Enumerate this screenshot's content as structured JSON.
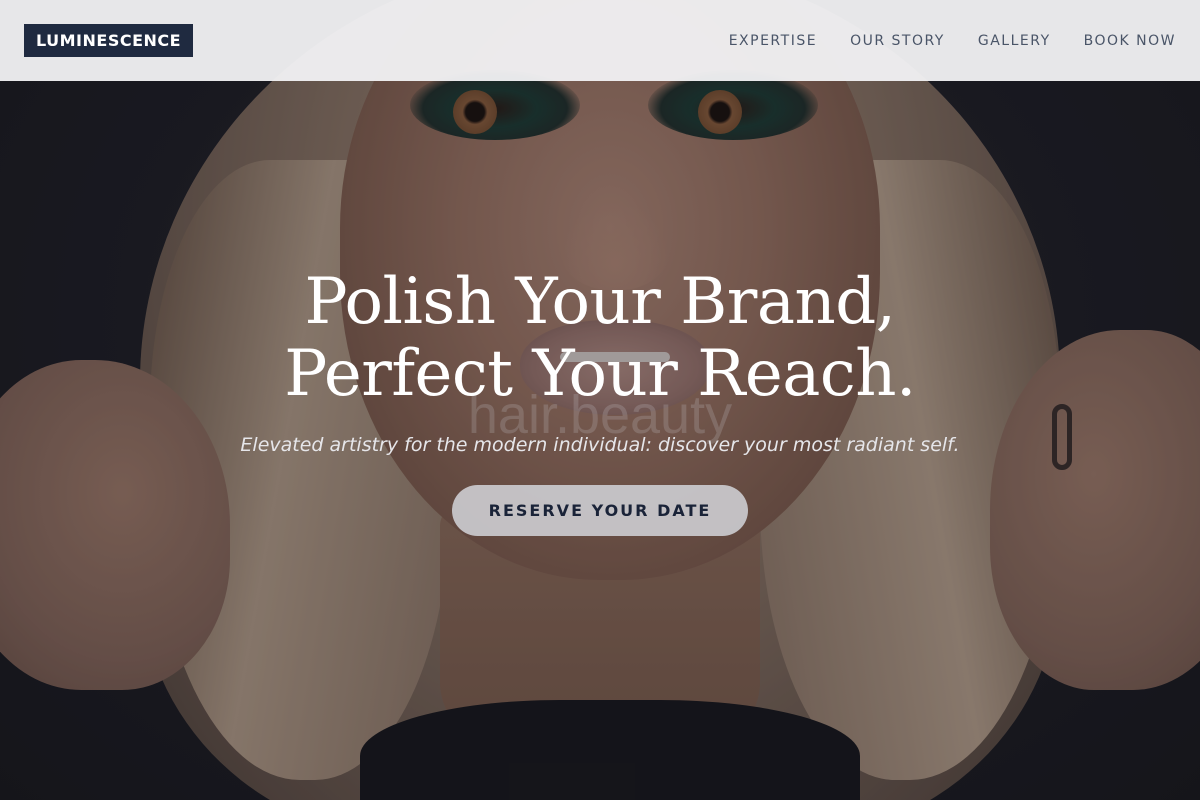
{
  "brand": {
    "logo": "LUMINESCENCE"
  },
  "nav": {
    "items": [
      "EXPERTISE",
      "OUR STORY",
      "GALLERY",
      "BOOK NOW"
    ]
  },
  "hero": {
    "title_line1": "Polish Your Brand,",
    "title_line2": "Perfect Your Reach.",
    "watermark": "hair.beauty",
    "subtitle": "Elevated artistry for the modern individual: discover your most radiant self.",
    "cta": "RESERVE YOUR DATE"
  },
  "colors": {
    "header_bg": "#f2f2f4",
    "logo_bg": "#1f2a40",
    "nav_text": "#4a5568",
    "cta_bg": "#cdcdd2",
    "cta_text": "#1a2338"
  }
}
